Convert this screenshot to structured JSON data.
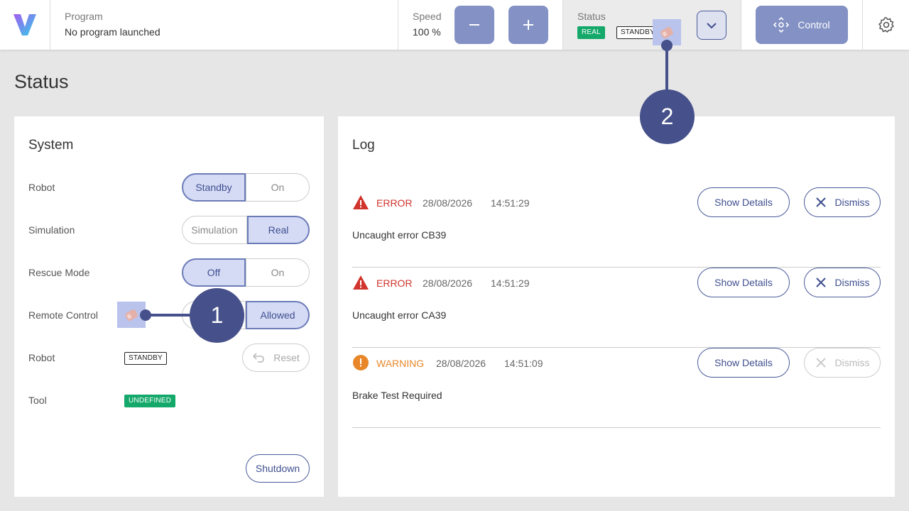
{
  "header": {
    "program_label": "Program",
    "program_value": "No program launched",
    "speed_label": "Speed",
    "speed_value": "100 %",
    "status_label": "Status",
    "status_badges": [
      "REAL",
      "STANDBY"
    ],
    "control_label": "Control"
  },
  "page_title": "Status",
  "system": {
    "title": "System",
    "robot_label": "Robot",
    "robot_options": [
      "Standby",
      "On"
    ],
    "simulation_label": "Simulation",
    "simulation_options": [
      "Simulation",
      "Real"
    ],
    "rescue_label": "Rescue Mode",
    "rescue_options": [
      "Off",
      "On"
    ],
    "remote_label": "Remote Control",
    "remote_options": [
      "",
      "Allowed"
    ],
    "robot_state_label": "Robot",
    "robot_state_badge": "STANDBY",
    "reset_label": "Reset",
    "tool_label": "Tool",
    "tool_badge": "UNDEFINED",
    "shutdown_label": "Shutdown"
  },
  "log": {
    "title": "Log",
    "entries": [
      {
        "level": "ERROR",
        "date": "28/08/2026",
        "time": "14:51:29",
        "message": "Uncaught error CB39",
        "details": "Show Details",
        "dismiss": "Dismiss"
      },
      {
        "level": "ERROR",
        "date": "28/08/2026",
        "time": "14:51:29",
        "message": "Uncaught error CA39",
        "details": "Show Details",
        "dismiss": "Dismiss"
      },
      {
        "level": "WARNING",
        "date": "28/08/2026",
        "time": "14:51:09",
        "message": "Brake Test Required",
        "details": "Show Details",
        "dismiss": "Dismiss"
      }
    ]
  },
  "annotations": {
    "callout_1": "1",
    "callout_2": "2"
  },
  "colors": {
    "accent": "#46508a",
    "button_fill": "#8391c4",
    "error": "#d0342c",
    "warning": "#e8872a",
    "badge_green": "#14a86a"
  },
  "icons": [
    "v-logo",
    "minus-icon",
    "plus-icon",
    "pencil-icon",
    "chevron-down-icon",
    "move-icon",
    "gear-icon",
    "undo-icon",
    "error-triangle-icon",
    "warning-circle-icon",
    "close-icon"
  ]
}
